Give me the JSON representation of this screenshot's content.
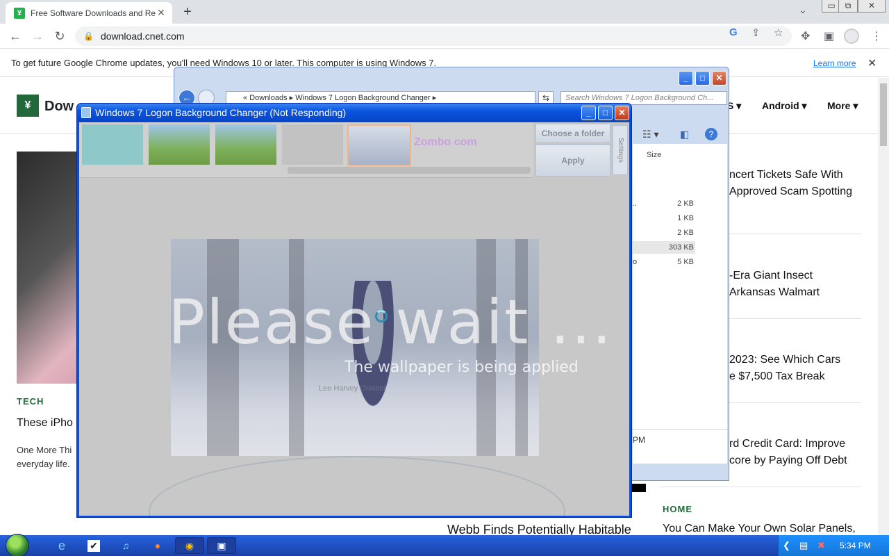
{
  "browser": {
    "tab_title": "Free Software Downloads and Revie",
    "tab_favicon_letter": "¥",
    "url": "download.cnet.com",
    "window_controls": {
      "minimize": "▭",
      "restore": "⧉",
      "close": "✕"
    }
  },
  "infobar": {
    "message": "To get future Google Chrome updates, you'll need Windows 10 or later. This computer is using Windows 7.",
    "learn_more": "Learn more"
  },
  "page": {
    "site_name": "Dow",
    "nav": [
      "S",
      "Android",
      "More"
    ],
    "hero_section": "TECH",
    "hero_headline": "These iPho",
    "hero_sub_1": "One More Thi",
    "hero_sub_2": "everyday life.",
    "sidebar_headlines": [
      {
        "line1": "ncert Tickets Safe With",
        "line2": "Approved Scam Spotting"
      },
      {
        "line1": "-Era Giant Insect",
        "line2": "Arkansas Walmart"
      },
      {
        "line1": "2023: See Which Cars",
        "line2": "e $7,500 Tax Break"
      },
      {
        "line1": "rd Credit Card: Improve",
        "line2": "core by Paying Off Debt"
      }
    ],
    "home_section": "HOME",
    "home_headline": "You Can Make Your Own Solar Panels,",
    "bottom_headline": "Webb Finds Potentially Habitable"
  },
  "explorer": {
    "address": [
      "Downloads",
      "Windows 7 Logon Background Changer"
    ],
    "search_placeholder": "Search Windows 7 Logon Background Ch...",
    "column_size": "Size",
    "files": [
      {
        "name": "..",
        "size": "2 KB"
      },
      {
        "name": "",
        "size": "1 KB"
      },
      {
        "name": "",
        "size": "2 KB"
      },
      {
        "name": "",
        "size": "303 KB"
      },
      {
        "name": "o",
        "size": "5 KB"
      }
    ],
    "details_time": "PM"
  },
  "changer": {
    "title": "Windows 7 Logon Background Changer (Not Responding)",
    "choose_folder": "Choose a folder",
    "apply": "Apply",
    "settings": "Settings",
    "thumb_brand": "Zombo com",
    "please_wait": "Please wait ...",
    "applying": "The wallpaper is being applied",
    "credit": "Lee Harvey Oswald"
  },
  "taskbar": {
    "clock": "5:34 PM",
    "buttons": [
      "ie-icon",
      "tasks-icon",
      "music-icon",
      "firefox-icon",
      "chrome-icon",
      "changer-icon"
    ]
  },
  "colors": {
    "cnet_green": "#22683a",
    "xp_blue": "#0b55e0",
    "taskbar_blue": "#245edb",
    "link_blue": "#1a73e8"
  }
}
